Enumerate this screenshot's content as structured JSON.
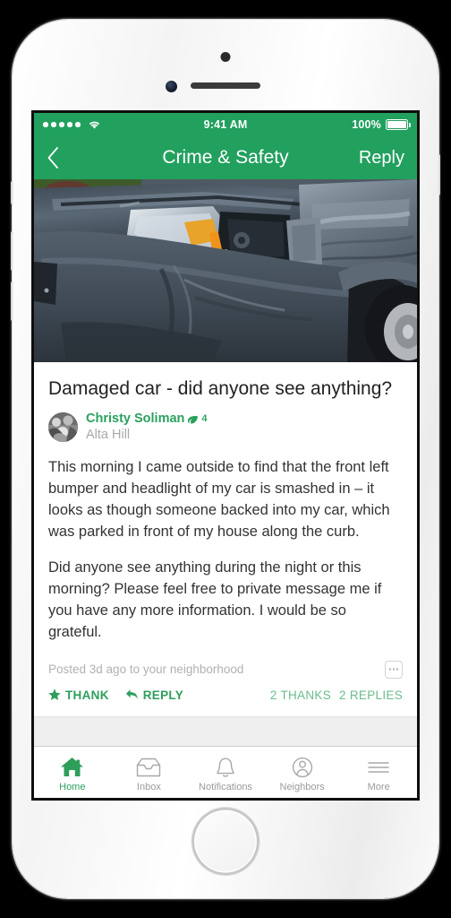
{
  "status_bar": {
    "carrier_dots": 5,
    "wifi_icon": "wifi-icon",
    "time": "9:41 AM",
    "battery_percent": "100%",
    "battery_icon": "battery-full-icon"
  },
  "nav_bar": {
    "back_icon": "chevron-left-icon",
    "title": "Crime & Safety",
    "reply_label": "Reply",
    "accent_color": "#22a05e"
  },
  "post": {
    "photo_alt": "damaged-car-front-end-photo",
    "title": "Damaged car - did anyone see anything?",
    "author": {
      "name": "Christy Soliman",
      "leaf_icon": "leaf-icon",
      "leaf_count": "4",
      "neighborhood": "Alta Hill",
      "avatar": "user-avatar"
    },
    "paragraphs": [
      "This morning I came outside to find that the front left bumper and headlight of my car is smashed in – it looks as though someone backed into my car, which was parked in front of my house along the curb.",
      "Did anyone see anything during the night or this morning? Please feel free to private message me if you have any more information. I would be so grateful."
    ],
    "posted_meta": "Posted 3d ago to your neighborhood",
    "more_options_icon": "ellipsis-icon",
    "actions": [
      {
        "label": "THANK",
        "icon": "star-icon"
      },
      {
        "label": "REPLY",
        "icon": "reply-arrow-icon"
      }
    ],
    "counts": [
      {
        "label": "2 THANKS"
      },
      {
        "label": "2 REPLIES"
      }
    ]
  },
  "tab_bar": {
    "items": [
      {
        "label": "Home",
        "icon": "house-icon",
        "active": true
      },
      {
        "label": "Inbox",
        "icon": "inbox-tray-icon",
        "active": false
      },
      {
        "label": "Notifications",
        "icon": "bell-icon",
        "active": false
      },
      {
        "label": "Neighbors",
        "icon": "person-circle-icon",
        "active": false
      },
      {
        "label": "More",
        "icon": "hamburger-icon",
        "active": false
      }
    ],
    "active_color": "#2aa15f",
    "inactive_color": "#9a9a9a"
  }
}
